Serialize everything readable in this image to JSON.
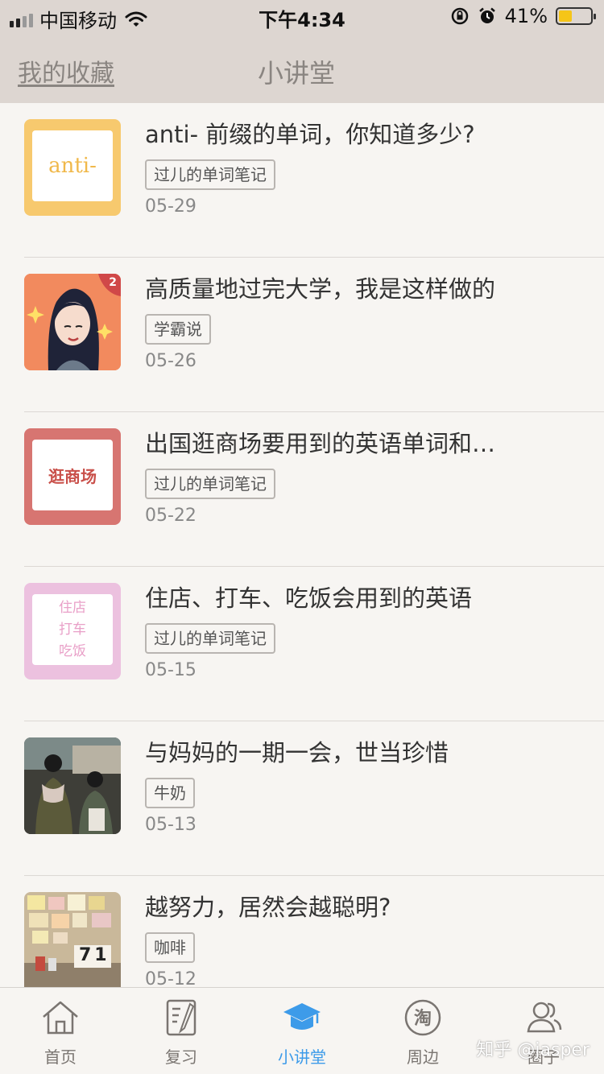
{
  "status_bar": {
    "carrier": "中国移动",
    "time": "下午4:34",
    "battery_pct": "41%",
    "battery_level": 0.41
  },
  "nav": {
    "left_link": "我的收藏",
    "title": "小讲堂"
  },
  "list": [
    {
      "title": "anti- 前缀的单词，你知道多少?",
      "tag": "过儿的单词笔记",
      "date": "05-29",
      "thumb_text": "anti-",
      "thumb_color": "#f7c96e",
      "thumb_text_color": "#f0b84a"
    },
    {
      "title": "高质量地过完大学，我是这样做的",
      "tag": "学霸说",
      "date": "05-26",
      "badge": "2",
      "thumb_color": "#f28a5e"
    },
    {
      "title": "出国逛商场要用到的英语单词和…",
      "tag": "过儿的单词笔记",
      "date": "05-22",
      "thumb_text": "逛商场",
      "thumb_color": "#d77571",
      "thumb_text_color": "#c9504a"
    },
    {
      "title": "住店、打车、吃饭会用到的英语",
      "tag": "过儿的单词笔记",
      "date": "05-15",
      "thumb_text": "住店 打车 吃饭",
      "thumb_color": "#ecc1df",
      "thumb_text_color": "#e9a0c8"
    },
    {
      "title": "与妈妈的一期一会，世当珍惜",
      "tag": "牛奶",
      "date": "05-13",
      "thumb_color": "#4b4a44"
    },
    {
      "title": "越努力，居然会越聪明?",
      "tag": "咖啡",
      "date": "05-12",
      "thumb_color": "#c9b89a",
      "thumb_text": "71"
    }
  ],
  "tabbar": [
    {
      "label": "首页",
      "icon": "home-icon",
      "active": false
    },
    {
      "label": "复习",
      "icon": "notebook-icon",
      "active": false
    },
    {
      "label": "小讲堂",
      "icon": "graduation-cap-icon",
      "active": true
    },
    {
      "label": "周边",
      "icon": "taobao-icon",
      "active": false
    },
    {
      "label": "圈子",
      "icon": "people-icon",
      "active": false
    }
  ],
  "watermark": "知乎 @jasper",
  "colors": {
    "header_bg": "#ddd6d1",
    "page_bg": "#f7f5f2",
    "accent": "#3d9be9"
  }
}
